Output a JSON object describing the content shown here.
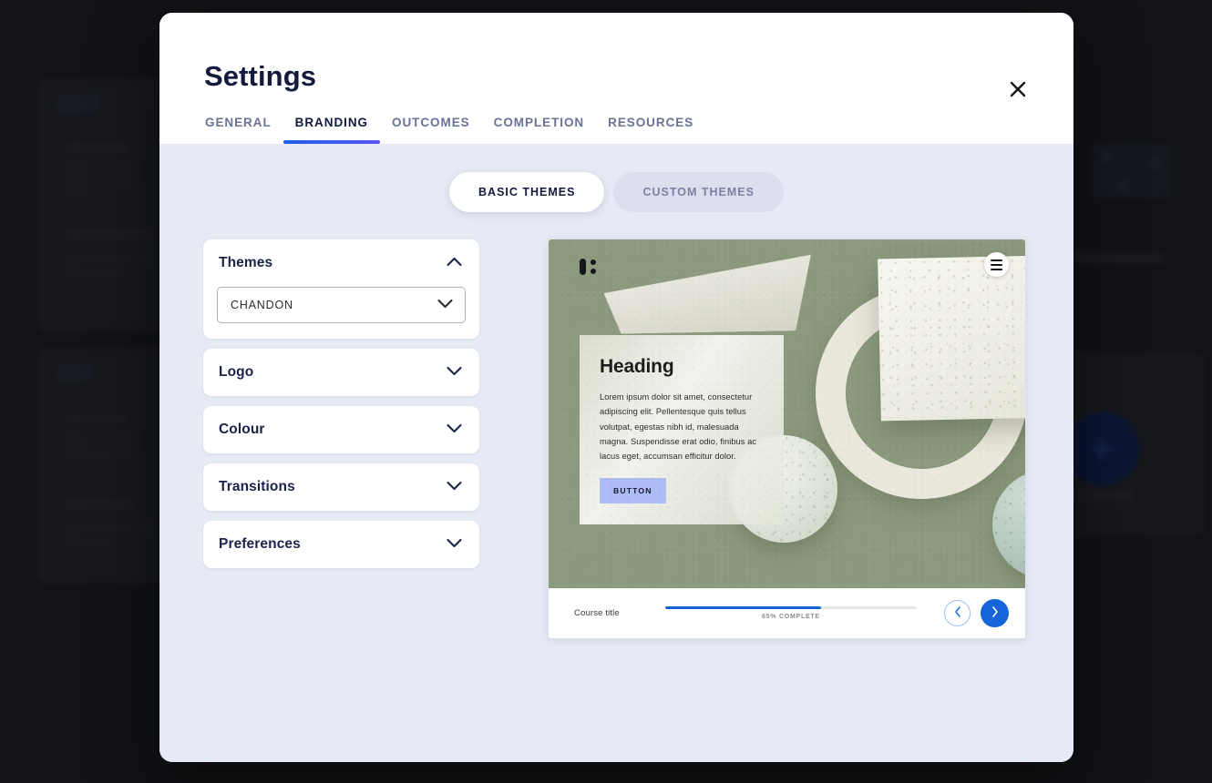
{
  "modal": {
    "title": "Settings",
    "close_label": "Close",
    "tabs": [
      {
        "label": "GENERAL",
        "active": false
      },
      {
        "label": "BRANDING",
        "active": true
      },
      {
        "label": "OUTCOMES",
        "active": false
      },
      {
        "label": "COMPLETION",
        "active": false
      },
      {
        "label": "RESOURCES",
        "active": false
      }
    ]
  },
  "theme_toggle": {
    "basic_label": "BASIC THEMES",
    "custom_label": "CUSTOM THEMES",
    "selected": "BASIC THEMES"
  },
  "accordion": {
    "panels": [
      {
        "title": "Themes",
        "expanded": true,
        "chevron": "chevron-up-icon"
      },
      {
        "title": "Logo",
        "expanded": false,
        "chevron": "chevron-down-icon"
      },
      {
        "title": "Colour",
        "expanded": false,
        "chevron": "chevron-down-icon"
      },
      {
        "title": "Transitions",
        "expanded": false,
        "chevron": "chevron-down-icon"
      },
      {
        "title": "Preferences",
        "expanded": false,
        "chevron": "chevron-down-icon"
      }
    ],
    "theme_select": {
      "value": "CHANDON",
      "chevron": "chevron-down-icon"
    }
  },
  "preview": {
    "brand_mark": "logo-mark-icon",
    "menu_icon": "hamburger-menu-icon",
    "card": {
      "heading": "Heading",
      "body": "Lorem ipsum dolor sit amet, consectetur adipiscing elit. Pellentesque quis tellus volutpat, egestas nibh id, malesuada magna. Suspendisse erat odio, finibus ac lacus eget, accumsan efficitur dolor.",
      "button_label": "BUTTON"
    },
    "footer": {
      "course_title": "Course title",
      "progress_label": "65% COMPLETE",
      "progress_percent": 62,
      "prev_icon": "chevron-left-icon",
      "next_icon": "chevron-right-icon"
    }
  },
  "colors": {
    "accent_blue": "#1565d8",
    "tab_underline_start": "#1f5ce0",
    "tab_underline_end": "#5b52ee",
    "modal_body_bg": "#e6eaf4",
    "title_navy": "#141a3c",
    "preview_bg_sage": "#8b9a7e",
    "preview_button_periwinkle": "#aebcf5"
  }
}
